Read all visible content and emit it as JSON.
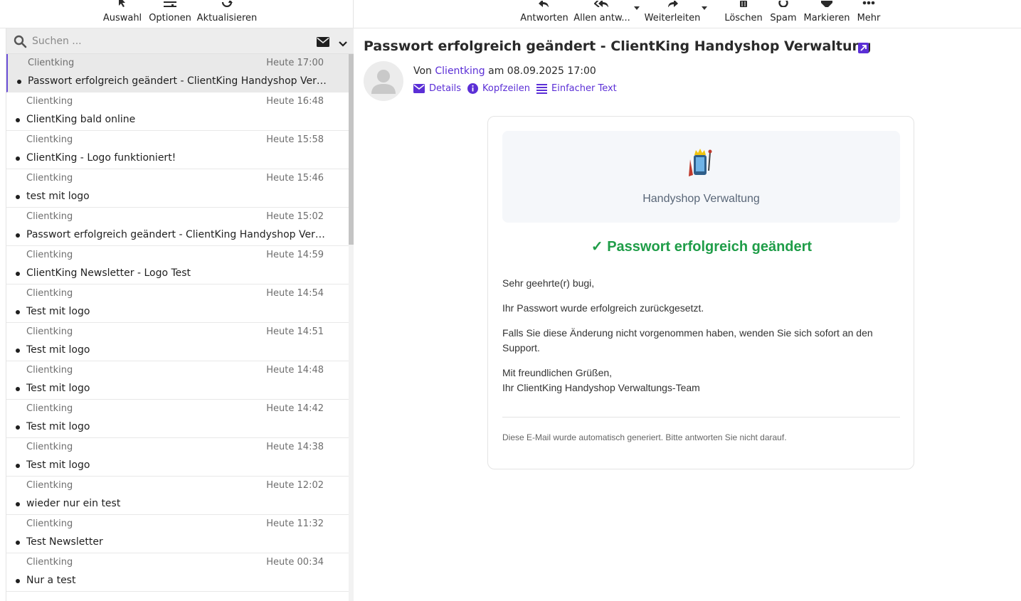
{
  "left_toolbar": {
    "select": "Auswahl",
    "options": "Optionen",
    "refresh": "Aktualisieren"
  },
  "search": {
    "placeholder": "Suchen ..."
  },
  "messages": [
    {
      "from": "Clientking",
      "date": "Heute 17:00",
      "subject": "Passwort erfolgreich geändert - ClientKing Handyshop Verwaltung",
      "selected": true
    },
    {
      "from": "Clientking",
      "date": "Heute 16:48",
      "subject": "ClientKing bald online"
    },
    {
      "from": "Clientking",
      "date": "Heute 15:58",
      "subject": "ClientKing - Logo funktioniert!"
    },
    {
      "from": "Clientking",
      "date": "Heute 15:46",
      "subject": "test mit logo"
    },
    {
      "from": "Clientking",
      "date": "Heute 15:02",
      "subject": "Passwort erfolgreich geändert - ClientKing Handyshop Verwaltung"
    },
    {
      "from": "Clientking",
      "date": "Heute 14:59",
      "subject": "ClientKing Newsletter - Logo Test"
    },
    {
      "from": "Clientking",
      "date": "Heute 14:54",
      "subject": "Test mit logo"
    },
    {
      "from": "Clientking",
      "date": "Heute 14:51",
      "subject": "Test mit logo"
    },
    {
      "from": "Clientking",
      "date": "Heute 14:48",
      "subject": "Test mit logo"
    },
    {
      "from": "Clientking",
      "date": "Heute 14:42",
      "subject": "Test mit logo"
    },
    {
      "from": "Clientking",
      "date": "Heute 14:38",
      "subject": "Test mit logo"
    },
    {
      "from": "Clientking",
      "date": "Heute 12:02",
      "subject": "wieder nur ein test"
    },
    {
      "from": "Clientking",
      "date": "Heute 11:32",
      "subject": "Test Newsletter"
    },
    {
      "from": "Clientking",
      "date": "Heute 00:34",
      "subject": "Nur a test"
    }
  ],
  "right_toolbar": {
    "reply": "Antworten",
    "reply_all": "Allen antw...",
    "forward": "Weiterleiten",
    "delete": "Löschen",
    "spam": "Spam",
    "mark": "Markieren",
    "more": "Mehr"
  },
  "message": {
    "title": "Passwort erfolgreich geändert - ClientKing Handyshop Verwaltung",
    "from_prefix": "Von",
    "from_name": "Clientking",
    "date_text": "am 08.09.2025 17:00",
    "links": {
      "details": "Details",
      "headers": "Kopfzeilen",
      "plain": "Einfacher Text"
    }
  },
  "email": {
    "brand": "Handyshop Verwaltung",
    "heading": "✓ Passwort erfolgreich geändert",
    "greeting": "Sehr geehrte(r) bugi,",
    "p1": "Ihr Passwort wurde erfolgreich zurückgesetzt.",
    "p2": "Falls Sie diese Änderung nicht vorgenommen haben, wenden Sie sich sofort an den Support.",
    "closing1": "Mit freundlichen Grüßen,",
    "closing2": "Ihr ClientKing Handyshop Verwaltungs-Team",
    "footer": "Diese E-Mail wurde automatisch generiert. Bitte antworten Sie nicht darauf."
  },
  "colors": {
    "accent": "#5b2fd6",
    "success": "#1f9d48"
  }
}
